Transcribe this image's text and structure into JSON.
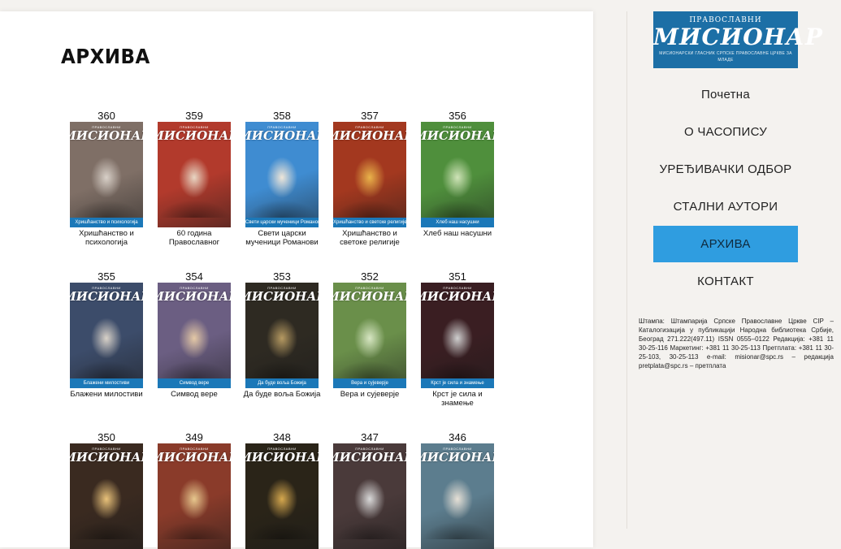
{
  "page": {
    "title": "АРХИВА"
  },
  "issues": [
    {
      "number": "360",
      "caption": "Хришћанство и психологија",
      "band": "Хришћанство и психологија",
      "bg": "#7f6f66",
      "fg": "#d8d0c8"
    },
    {
      "number": "359",
      "caption": "60 година Православног",
      "band": "",
      "bg": "#b23a2c",
      "fg": "#e8d7c4"
    },
    {
      "number": "358",
      "caption": "Свети царски мученици Романови",
      "band": "Свети царски мученици Романови",
      "bg": "#3f8cd1",
      "fg": "#f0e6d8"
    },
    {
      "number": "357",
      "caption": "Хришћанство и светоке религије",
      "band": "Хришћанство и светске религије",
      "bg": "#a3381f",
      "fg": "#e9b34a"
    },
    {
      "number": "356",
      "caption": "Хлеб наш насушни",
      "band": "Хлеб наш насушни",
      "bg": "#4f8f3c",
      "fg": "#cfe3b8"
    },
    {
      "number": "355",
      "caption": "Блажени милостиви",
      "band": "Блажени милостиви",
      "bg": "#3c4c6a",
      "fg": "#d9d2c8"
    },
    {
      "number": "354",
      "caption": "Симвод вере",
      "band": "Симвод вере",
      "bg": "#6b5e82",
      "fg": "#e5c9a6"
    },
    {
      "number": "353",
      "caption": "Да буде вољa Божија",
      "band": "Да буде воља Божија",
      "bg": "#2e2a22",
      "fg": "#b69a62"
    },
    {
      "number": "352",
      "caption": "Вера и сујеверје",
      "band": "Вера и сујеверје",
      "bg": "#6a8f4a",
      "fg": "#d7e6c3"
    },
    {
      "number": "351",
      "caption": "Крст је сила и знамење",
      "band": "Крст је сила и знамење",
      "bg": "#3a1e22",
      "fg": "#cfcfcf"
    },
    {
      "number": "350",
      "caption": "",
      "band": "",
      "bg": "#3a2a20",
      "fg": "#e9c27a"
    },
    {
      "number": "349",
      "caption": "",
      "band": "",
      "bg": "#8a3b2a",
      "fg": "#e7c88e"
    },
    {
      "number": "348",
      "caption": "",
      "band": "",
      "bg": "#2a2418",
      "fg": "#d6a84e"
    },
    {
      "number": "347",
      "caption": "",
      "band": "",
      "bg": "#4a3a3a",
      "fg": "#d9d9d9"
    },
    {
      "number": "346",
      "caption": "",
      "band": "",
      "bg": "#5c7d8e",
      "fg": "#e6e0d6"
    }
  ],
  "cover": {
    "mast_small": "ПРАВОСЛАВНИ",
    "mast_big": "МИСИОНАР"
  },
  "sidebar": {
    "logo_top": "ПРАВОСЛАВНИ",
    "logo_main": "МИСИОНАР",
    "logo_sub": "МИСИОНАРСКИ ГЛАСНИК СРПСКЕ ПРАВОСЛАВНЕ ЦРКВЕ ЗА МЛАДЕ",
    "nav": [
      {
        "label": "Почетна",
        "active": false
      },
      {
        "label": "О ЧАСОПИСУ",
        "active": false
      },
      {
        "label": "УРЕЂИВАЧКИ ОДБОР",
        "active": false
      },
      {
        "label": "СТАЛНИ АУТОРИ",
        "active": false
      },
      {
        "label": "АРХИВА",
        "active": true
      },
      {
        "label": "КОНТАКТ",
        "active": false
      }
    ],
    "imprint": "Штампа: Штампарија Српске Православне Цркве CIP – Каталогизација у публикацији Народна библиотека Србије, Београд 271.222(497.11) ISSN 0555–0122 Редакција: +381 11 30-25-116 Маркетинг: +381 11 30-25-113 Претплата: +381 11 30-25-103, 30-25-113 e-mail: misionar@spc.rs – редакција pretplata@spc.rs – претплата"
  },
  "colors": {
    "accent": "#2f9de0",
    "logo_bg": "#1c6fa6",
    "band": "#1b78b8"
  }
}
